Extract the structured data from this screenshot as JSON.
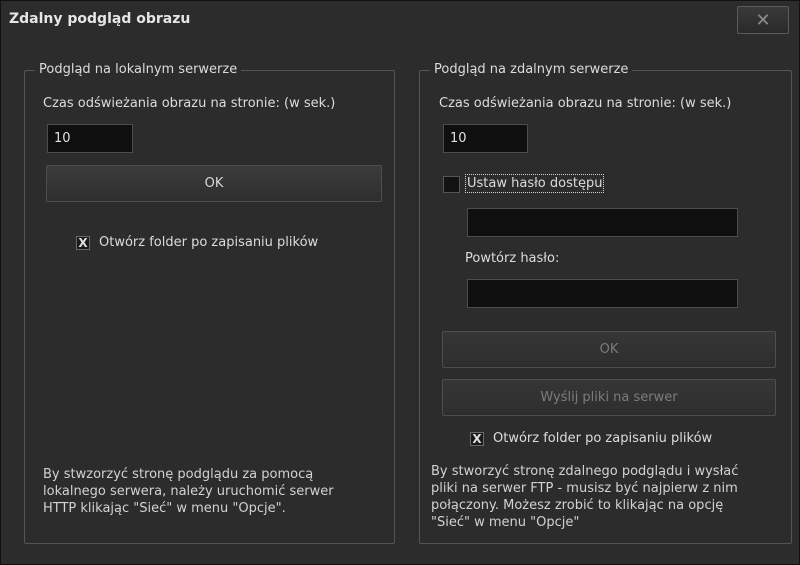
{
  "window": {
    "title": "Zdalny podgląd obrazu",
    "close_label": "✕"
  },
  "local": {
    "legend": "Podgląd na lokalnym serwerze",
    "refresh_label": "Czas odświeżania obrazu na stronie: (w sek.)",
    "refresh_value": "10",
    "ok_label": "OK",
    "open_folder_label": "Otwórz folder po zapisaniu plików",
    "open_folder_mark": "X",
    "info_lines": [
      "By stwzorzyć stronę podglądu za pomocą",
      "lokalnego serwera, należy uruchomić serwer",
      "HTTP klikając \"Sieć\" w menu \"Opcje\"."
    ]
  },
  "remote": {
    "legend": "Podgląd na zdalnym serwerze",
    "refresh_label": "Czas odświeżania obrazu na stronie: (w sek.)",
    "refresh_value": "10",
    "set_password_label": "Ustaw hasło dostępu",
    "password_value": "",
    "repeat_password_label": "Powtórz hasło:",
    "repeat_password_value": "",
    "ok_label": "OK",
    "send_files_label": "Wyślij pliki na serwer",
    "open_folder_label": "Otwórz folder po zapisaniu plików",
    "open_folder_mark": "X",
    "info_lines": [
      "By stworzyć stronę zdalnego podglądu i wysłać",
      "pliki na serwer FTP - musisz być najpierw z nim",
      "połączony. Możesz zrobić to klikając na opcję",
      "\"Sieć\" w menu \"Opcje\""
    ]
  }
}
